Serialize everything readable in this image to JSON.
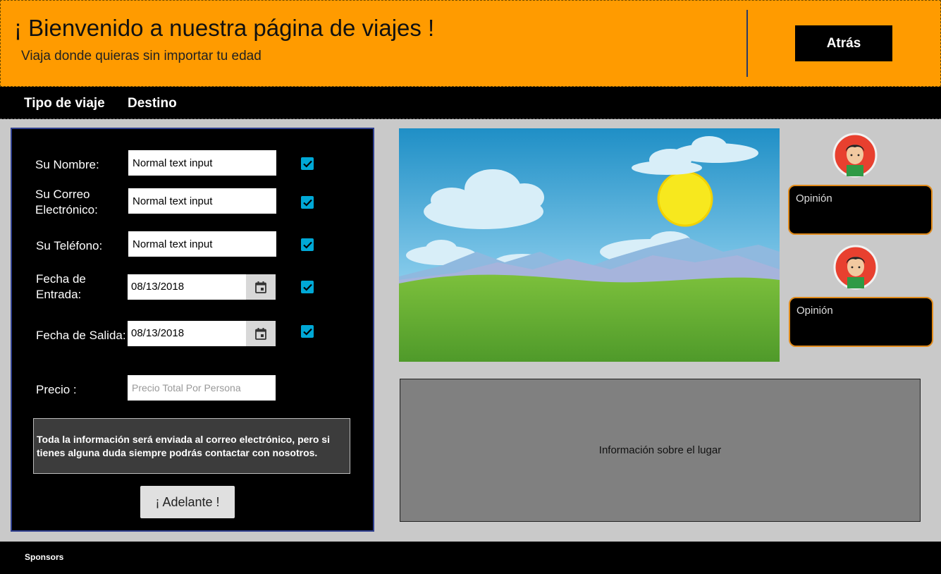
{
  "header": {
    "title": "¡ Bienvenido a nuestra página de viajes !",
    "subtitle": "Viaja donde quieras sin importar tu edad",
    "back_button": "Atrás"
  },
  "nav": {
    "items": [
      {
        "label": "Tipo de viaje"
      },
      {
        "label": "Destino"
      }
    ]
  },
  "form": {
    "name_label": "Su Nombre:",
    "email_label_line1": "Su Correo",
    "email_label_line2": "Electrónico:",
    "phone_label": "Su Teléfono:",
    "checkin_label_line1": "Fecha de",
    "checkin_label_line2": "Entrada:",
    "checkout_label": "Fecha de Salida:",
    "price_label": "Precio :",
    "name_value": "Normal text input",
    "email_value": "Normal text input",
    "phone_value": "Normal text input",
    "checkin_value": "08/13/2018",
    "checkout_value": "08/13/2018",
    "price_placeholder": "Precio Total Por Persona",
    "checkboxes_checked": [
      true,
      true,
      true,
      true,
      true
    ],
    "info_text": "Toda la información será enviada al correo electrónico, pero si tienes alguna duda siempre podrás contactar con nosotros.",
    "submit_label": "¡ Adelante !"
  },
  "opinions": [
    {
      "label": "Opinión"
    },
    {
      "label": "Opinión"
    }
  ],
  "place_info": "Información sobre el lugar",
  "footer": {
    "label": "Sponsors"
  },
  "colors": {
    "header_bg": "#ff9b00",
    "nav_bg": "#000000",
    "checkbox": "#00a8d6",
    "opinion_border": "#e08a1a",
    "avatar_bg": "#e8402f"
  },
  "icons": [
    "calendar-icon",
    "checkmark-icon",
    "user-avatar-icon"
  ]
}
